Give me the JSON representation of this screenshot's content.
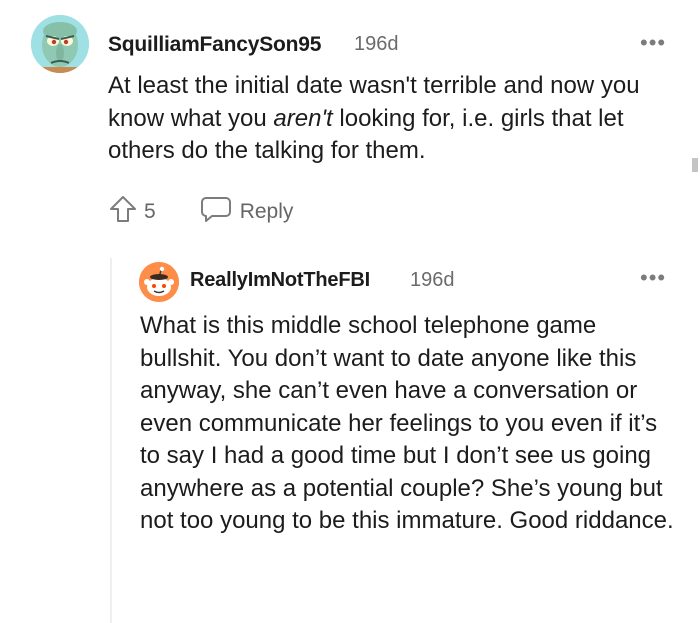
{
  "comments": [
    {
      "username": "SquilliamFancySon95",
      "age": "196d",
      "more_label": "•••",
      "body_pre": "At least the initial date wasn't terrible and now you know what you ",
      "body_em": "aren't",
      "body_post": " looking for, i.e. girls that let others do the talking for them.",
      "votes": "5",
      "reply_label": "Reply",
      "avatar_icon": "squidward-avatar-icon"
    },
    {
      "username": "ReallyImNotTheFBI",
      "age": "196d",
      "more_label": "•••",
      "body": "What is this middle school telephone game bullshit. You don’t want to date anyone like this anyway, she can’t even have a conversation or even communicate her feelings to you even if it’s to say I had a good time but I don’t see us going anywhere as a potential couple? She’s young but not too young to be this immature. Good riddance.",
      "avatar_icon": "snoo-avatar-icon"
    }
  ],
  "colors": {
    "text": "#1c1c1c",
    "meta": "#6b6b6b",
    "avatar1_bg": "#9fe0e4",
    "avatar2_bg": "#ff8d4a"
  }
}
